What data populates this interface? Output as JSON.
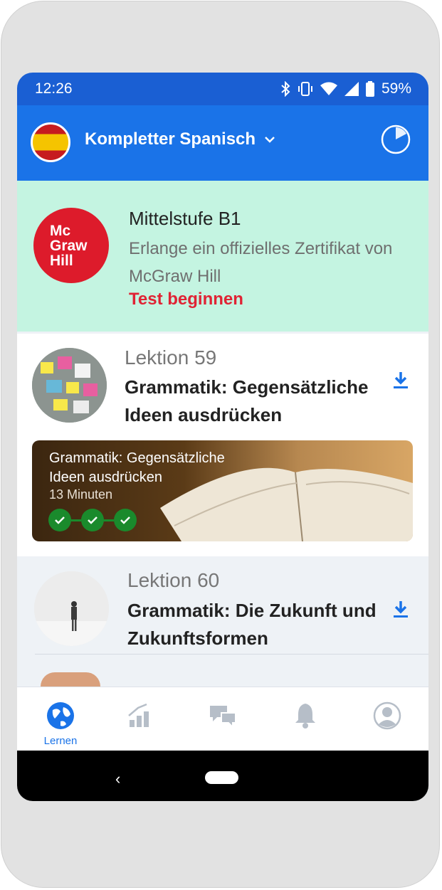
{
  "status_bar": {
    "time": "12:26",
    "battery": "59%"
  },
  "header": {
    "course_title": "Kompletter Spanisch"
  },
  "promo": {
    "logo_text": [
      "Mc",
      "Graw",
      "Hill"
    ],
    "title": "Mittelstufe B1",
    "description": "Erlange ein offizielles Zertifikat von McGraw Hill",
    "cta": "Test beginnen"
  },
  "lessons": [
    {
      "number": "Lektion 59",
      "title": "Grammatik: Gegensätzliche Ideen ausdrücken",
      "activity": {
        "title": "Grammatik: Gegensätzliche Ideen ausdrücken",
        "duration": "13 Minuten",
        "completed_steps": 3
      }
    },
    {
      "number": "Lektion 60",
      "title": "Grammatik: Die Zukunft und Zukunftsformen"
    }
  ],
  "tabs": [
    {
      "label": "Lernen",
      "icon": "globe-icon",
      "active": true
    },
    {
      "label": "",
      "icon": "stats-icon"
    },
    {
      "label": "",
      "icon": "chat-icon"
    },
    {
      "label": "",
      "icon": "bell-icon"
    },
    {
      "label": "",
      "icon": "profile-icon"
    }
  ],
  "colors": {
    "header": "#1a73e8",
    "promo_bg": "#c4f4e1",
    "cta": "#e02334",
    "check": "#1a8a2c"
  }
}
